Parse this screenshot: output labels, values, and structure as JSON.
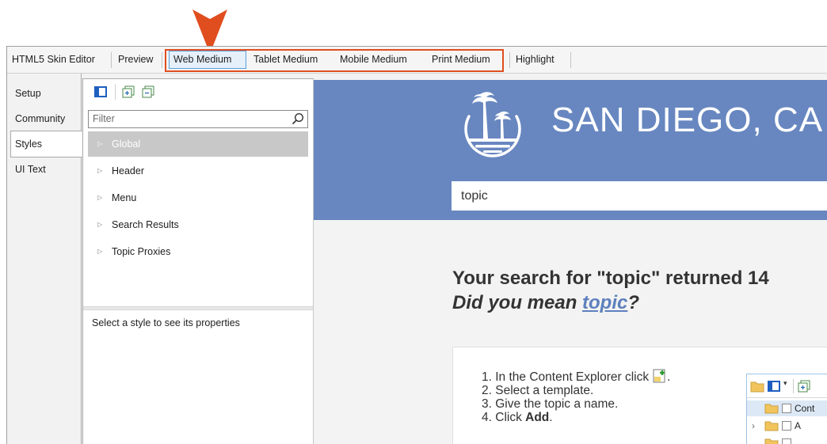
{
  "toolbar": {
    "items": [
      "HTML5 Skin Editor",
      "Preview",
      "Web Medium",
      "Tablet Medium",
      "Mobile Medium",
      "Print Medium",
      "Highlight"
    ],
    "selected": "Web Medium"
  },
  "vtabs": [
    "Setup",
    "Community",
    "Styles",
    "UI Text"
  ],
  "active_vtab": "Styles",
  "styles_panel": {
    "filter_placeholder": "Filter",
    "items": [
      "Global",
      "Header",
      "Menu",
      "Search Results",
      "Topic Proxies"
    ],
    "selected_item": "Global",
    "properties_hint": "Select a style to see its properties"
  },
  "preview": {
    "site_title": "SAN DIEGO, CA",
    "search_value": "topic",
    "results_heading": "Your search for \"topic\" returned 14",
    "did_you_mean_prefix": "Did you mean ",
    "did_you_mean_link": "topic",
    "did_you_mean_suffix": "?",
    "steps": [
      {
        "num": "1.",
        "text": "In the Content Explorer click",
        "suffix": "."
      },
      {
        "num": "2.",
        "text": "Select a template."
      },
      {
        "num": "3.",
        "text": "Give the topic a name."
      },
      {
        "num": "4.",
        "text": "Click ",
        "bold": "Add",
        "suffix": "."
      }
    ],
    "mini_explorer": {
      "row1": "Cont",
      "row2": "A"
    }
  },
  "colors": {
    "accent_callout": "#e04e1f",
    "header_blue": "#6887c0",
    "link_blue": "#5d80bd"
  }
}
